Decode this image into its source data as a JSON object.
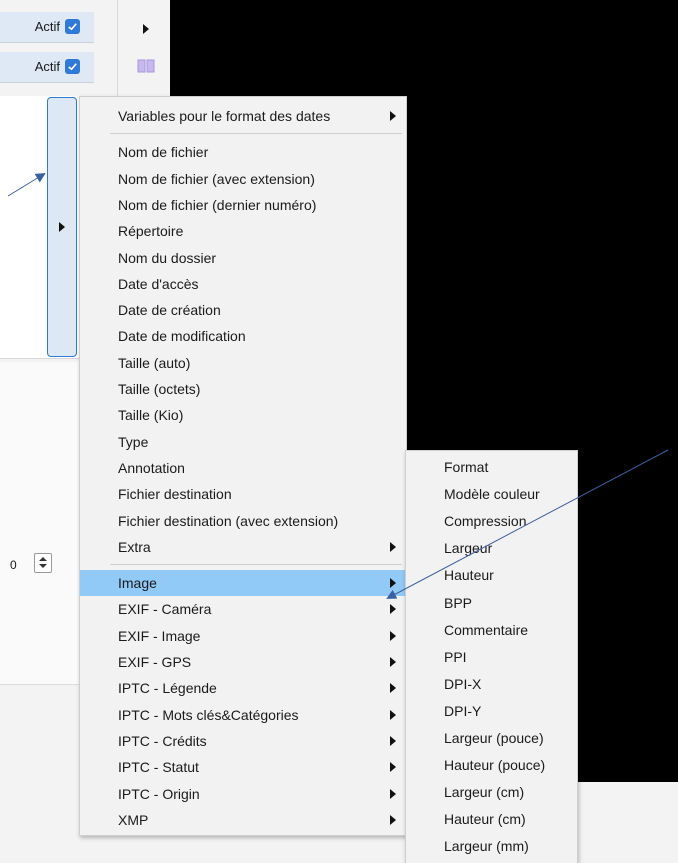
{
  "rows": [
    {
      "label": "Actif",
      "checked": true
    },
    {
      "label": "Actif",
      "checked": true
    }
  ],
  "spinner": {
    "value": "0"
  },
  "menu": {
    "groups": [
      [
        {
          "label": "Variables pour le format des dates",
          "submenu": true
        }
      ],
      [
        {
          "label": "Nom de fichier"
        },
        {
          "label": "Nom de fichier (avec extension)"
        },
        {
          "label": "Nom de fichier (dernier numéro)"
        },
        {
          "label": "Répertoire"
        },
        {
          "label": "Nom du dossier"
        },
        {
          "label": "Date d'accès"
        },
        {
          "label": "Date de création"
        },
        {
          "label": "Date de modification"
        },
        {
          "label": "Taille (auto)"
        },
        {
          "label": "Taille (octets)"
        },
        {
          "label": "Taille (Kio)"
        },
        {
          "label": "Type"
        },
        {
          "label": "Annotation"
        },
        {
          "label": "Fichier destination"
        },
        {
          "label": "Fichier destination (avec extension)"
        },
        {
          "label": "Extra",
          "submenu": true
        }
      ],
      [
        {
          "label": "Image",
          "submenu": true,
          "highlighted": true
        },
        {
          "label": "EXIF - Caméra",
          "submenu": true
        },
        {
          "label": "EXIF - Image",
          "submenu": true
        },
        {
          "label": "EXIF - GPS",
          "submenu": true
        },
        {
          "label": "IPTC - Légende",
          "submenu": true
        },
        {
          "label": "IPTC - Mots clés&Catégories",
          "submenu": true
        },
        {
          "label": "IPTC - Crédits",
          "submenu": true
        },
        {
          "label": "IPTC - Statut",
          "submenu": true
        },
        {
          "label": "IPTC - Origin",
          "submenu": true
        },
        {
          "label": "XMP",
          "submenu": true
        }
      ]
    ]
  },
  "submenu": {
    "items": [
      "Format",
      "Modèle couleur",
      "Compression",
      "Largeur",
      "Hauteur",
      "BPP",
      "Commentaire",
      "PPI",
      "DPI-X",
      "DPI-Y",
      "Largeur (pouce)",
      "Hauteur (pouce)",
      "Largeur (cm)",
      "Hauteur (cm)",
      "Largeur (mm)"
    ]
  },
  "colors": {
    "highlight": "#91c9f7",
    "accent": "#2f7ad6",
    "annotation_arrow": "#3b5fa0"
  }
}
